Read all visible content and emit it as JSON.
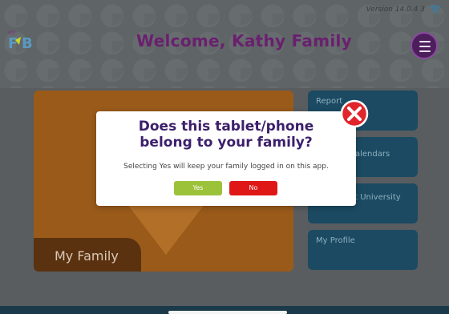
{
  "header": {
    "version": "Version 14.0.4 3",
    "title": "Welcome, Kathy Family"
  },
  "main": {
    "family_card_label": "My Family",
    "side_buttons": [
      {
        "label": "Report"
      },
      {
        "label": "Calendars"
      },
      {
        "label": "at University"
      },
      {
        "label": "My Profile"
      }
    ]
  },
  "modal": {
    "title_line1": "Does this tablet/phone",
    "title_line2": "belong to your family?",
    "message": "Selecting Yes will keep your family logged in on this app.",
    "yes_label": "Yes",
    "no_label": "No"
  },
  "icons": {
    "wifi": "wifi-icon",
    "menu": "hamburger-menu-icon",
    "close": "close-x-icon",
    "logo": "fb-logo"
  },
  "colors": {
    "title_purple": "#6a1f6f",
    "yes_green": "#9cc23a",
    "no_red": "#e01717",
    "close_red": "#e0252b",
    "card_orange": "#9a5a1a",
    "side_button_blue": "#1b4a62"
  }
}
